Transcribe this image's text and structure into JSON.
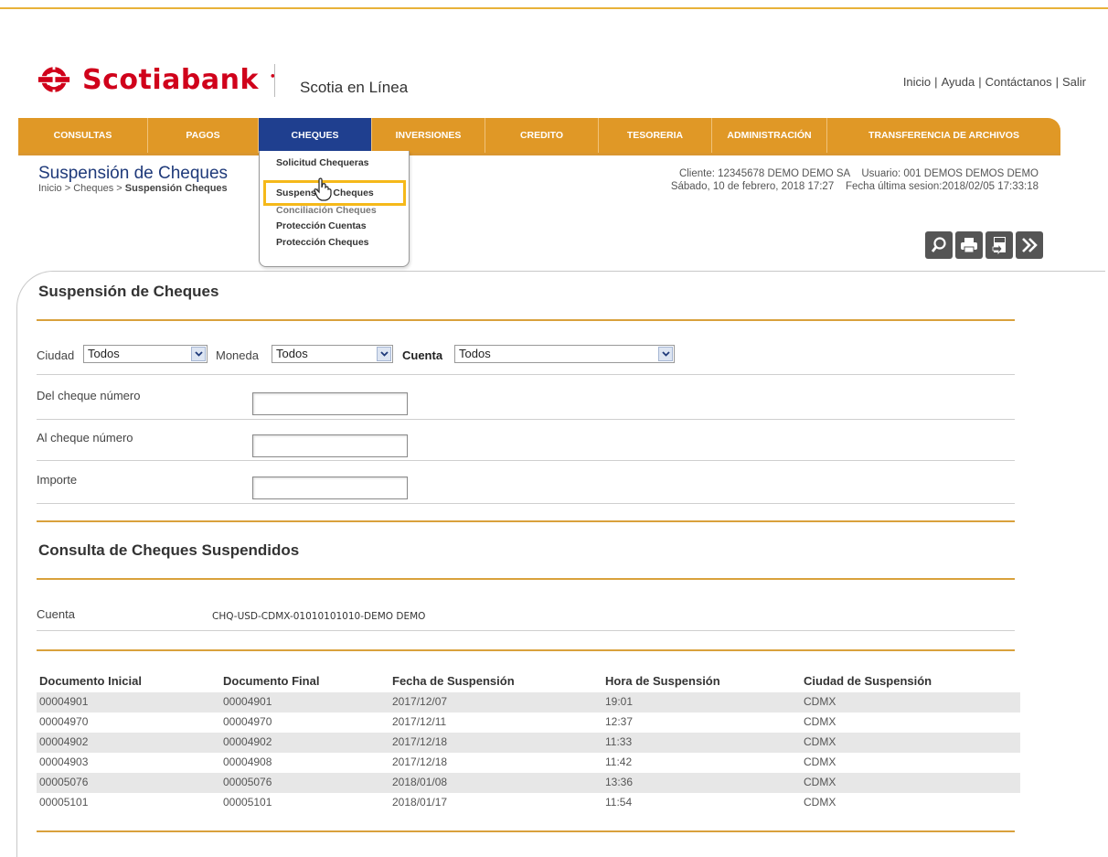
{
  "header": {
    "brand": "Scotiabank",
    "product": "Scotia en Línea",
    "links": [
      "Inicio",
      "Ayuda",
      "Contáctanos",
      "Salir"
    ],
    "brand_color": "#d0021b"
  },
  "nav": {
    "items": [
      "CONSULTAS",
      "PAGOS",
      "CHEQUES",
      "INVERSIONES",
      "CREDITO",
      "TESORERIA",
      "ADMINISTRACIÓN",
      "TRANSFERENCIA DE ARCHIVOS"
    ],
    "active": "CHEQUES",
    "bar_color": "#e09826",
    "active_color": "#1f3f8f"
  },
  "page": {
    "title": "Suspensión de Cheques",
    "breadcrumb_prefix": "Inicio > Cheques > ",
    "breadcrumb_current": "Suspensión Cheques"
  },
  "info": {
    "line1": "Cliente: 12345678 DEMO DEMO SA    Usuario: 001 DEMOS DEMOS DEMO",
    "line2": "Sábado, 10 de febrero, 2018 17:27    Fecha última sesion:2018/02/05 17:33:18"
  },
  "dropdown": {
    "items": [
      "Solicitud Chequeras",
      "Suspensión Cheques",
      "Conciliación Cheques",
      "Protección Cuentas",
      "Protección Cheques"
    ],
    "selected": "Suspensión Cheques"
  },
  "tools": [
    "search-icon",
    "print-icon",
    "txt-export-icon",
    "next-icon"
  ],
  "form": {
    "title": "Suspensión de Cheques",
    "ciudad_label": "Ciudad",
    "ciudad_value": "Todos",
    "moneda_label": "Moneda",
    "moneda_value": "Todos",
    "cuenta_label": "Cuenta",
    "cuenta_value": "Todos",
    "del_label": "Del cheque número",
    "al_label": "Al cheque número",
    "importe_label": "Importe"
  },
  "consulta": {
    "title": "Consulta de Cheques Suspendidos",
    "cuenta_label": "Cuenta",
    "cuenta_value": "CHQ-USD-CDMX-01010101010-DEMO DEMO"
  },
  "table": {
    "headers": [
      "Documento Inicial",
      "Documento Final",
      "Fecha de Suspensión",
      "Hora de Suspensión",
      "Ciudad de Suspensión"
    ],
    "rows": [
      [
        "00004901",
        "00004901",
        "2017/12/07",
        "19:01",
        "CDMX"
      ],
      [
        "00004970",
        "00004970",
        "2017/12/11",
        "12:37",
        "CDMX"
      ],
      [
        "00004902",
        "00004902",
        "2017/12/18",
        "11:33",
        "CDMX"
      ],
      [
        "00004903",
        "00004908",
        "2017/12/18",
        "11:42",
        "CDMX"
      ],
      [
        "00005076",
        "00005076",
        "2018/01/08",
        "13:36",
        "CDMX"
      ],
      [
        "00005101",
        "00005101",
        "2018/01/17",
        "11:54",
        "CDMX"
      ]
    ]
  }
}
